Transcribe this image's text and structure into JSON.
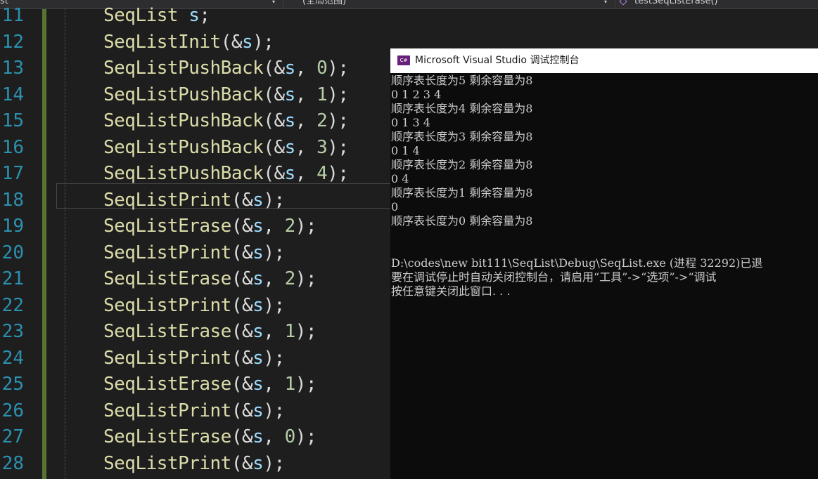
{
  "navbar": {
    "project_dropdown": "st",
    "scope_dropdown": "(全局范围)",
    "member_dropdown": "testSeqListErase()"
  },
  "editor": {
    "lines": [
      {
        "num": "11",
        "tokens": [
          [
            "fn",
            "SeqList"
          ],
          [
            "punc",
            " "
          ],
          [
            "var",
            "s"
          ],
          [
            "punc",
            ";"
          ]
        ]
      },
      {
        "num": "12",
        "tokens": [
          [
            "fn",
            "SeqListInit"
          ],
          [
            "punc",
            "(&"
          ],
          [
            "var",
            "s"
          ],
          [
            "punc",
            ");"
          ]
        ]
      },
      {
        "num": "13",
        "tokens": [
          [
            "fn",
            "SeqListPushBack"
          ],
          [
            "punc",
            "(&"
          ],
          [
            "var",
            "s"
          ],
          [
            "punc",
            ", "
          ],
          [
            "num",
            "0"
          ],
          [
            "punc",
            ");"
          ]
        ]
      },
      {
        "num": "14",
        "tokens": [
          [
            "fn",
            "SeqListPushBack"
          ],
          [
            "punc",
            "(&"
          ],
          [
            "var",
            "s"
          ],
          [
            "punc",
            ", "
          ],
          [
            "num",
            "1"
          ],
          [
            "punc",
            ");"
          ]
        ]
      },
      {
        "num": "15",
        "tokens": [
          [
            "fn",
            "SeqListPushBack"
          ],
          [
            "punc",
            "(&"
          ],
          [
            "var",
            "s"
          ],
          [
            "punc",
            ", "
          ],
          [
            "num",
            "2"
          ],
          [
            "punc",
            ");"
          ]
        ]
      },
      {
        "num": "16",
        "tokens": [
          [
            "fn",
            "SeqListPushBack"
          ],
          [
            "punc",
            "(&"
          ],
          [
            "var",
            "s"
          ],
          [
            "punc",
            ", "
          ],
          [
            "num",
            "3"
          ],
          [
            "punc",
            ");"
          ]
        ]
      },
      {
        "num": "17",
        "tokens": [
          [
            "fn",
            "SeqListPushBack"
          ],
          [
            "punc",
            "(&"
          ],
          [
            "var",
            "s"
          ],
          [
            "punc",
            ", "
          ],
          [
            "num",
            "4"
          ],
          [
            "punc",
            ");"
          ]
        ]
      },
      {
        "num": "18",
        "tokens": [
          [
            "fn",
            "SeqListPrint"
          ],
          [
            "punc",
            "(&"
          ],
          [
            "var",
            "s"
          ],
          [
            "punc",
            ");"
          ]
        ]
      },
      {
        "num": "19",
        "tokens": [
          [
            "fn",
            "SeqListErase"
          ],
          [
            "punc",
            "(&"
          ],
          [
            "var",
            "s"
          ],
          [
            "punc",
            ", "
          ],
          [
            "num",
            "2"
          ],
          [
            "punc",
            ");"
          ]
        ]
      },
      {
        "num": "20",
        "tokens": [
          [
            "fn",
            "SeqListPrint"
          ],
          [
            "punc",
            "(&"
          ],
          [
            "var",
            "s"
          ],
          [
            "punc",
            ");"
          ]
        ]
      },
      {
        "num": "21",
        "tokens": [
          [
            "fn",
            "SeqListErase"
          ],
          [
            "punc",
            "(&"
          ],
          [
            "var",
            "s"
          ],
          [
            "punc",
            ", "
          ],
          [
            "num",
            "2"
          ],
          [
            "punc",
            ");"
          ]
        ]
      },
      {
        "num": "22",
        "tokens": [
          [
            "fn",
            "SeqListPrint"
          ],
          [
            "punc",
            "(&"
          ],
          [
            "var",
            "s"
          ],
          [
            "punc",
            ");"
          ]
        ]
      },
      {
        "num": "23",
        "tokens": [
          [
            "fn",
            "SeqListErase"
          ],
          [
            "punc",
            "(&"
          ],
          [
            "var",
            "s"
          ],
          [
            "punc",
            ", "
          ],
          [
            "num",
            "1"
          ],
          [
            "punc",
            ");"
          ]
        ]
      },
      {
        "num": "24",
        "tokens": [
          [
            "fn",
            "SeqListPrint"
          ],
          [
            "punc",
            "(&"
          ],
          [
            "var",
            "s"
          ],
          [
            "punc",
            ");"
          ]
        ]
      },
      {
        "num": "25",
        "tokens": [
          [
            "fn",
            "SeqListErase"
          ],
          [
            "punc",
            "(&"
          ],
          [
            "var",
            "s"
          ],
          [
            "punc",
            ", "
          ],
          [
            "num",
            "1"
          ],
          [
            "punc",
            ");"
          ]
        ]
      },
      {
        "num": "26",
        "tokens": [
          [
            "fn",
            "SeqListPrint"
          ],
          [
            "punc",
            "(&"
          ],
          [
            "var",
            "s"
          ],
          [
            "punc",
            ");"
          ]
        ]
      },
      {
        "num": "27",
        "tokens": [
          [
            "fn",
            "SeqListErase"
          ],
          [
            "punc",
            "(&"
          ],
          [
            "var",
            "s"
          ],
          [
            "punc",
            ", "
          ],
          [
            "num",
            "0"
          ],
          [
            "punc",
            ");"
          ]
        ]
      },
      {
        "num": "28",
        "tokens": [
          [
            "fn",
            "SeqListPrint"
          ],
          [
            "punc",
            "(&"
          ],
          [
            "var",
            "s"
          ],
          [
            "punc",
            ");"
          ]
        ]
      }
    ]
  },
  "console": {
    "title": "Microsoft Visual Studio 调试控制台",
    "icon_label": "C#",
    "lines": [
      "顺序表长度为5 剩余容量为8",
      "0 1 2 3 4",
      "顺序表长度为4 剩余容量为8",
      "0 1 3 4",
      "顺序表长度为3 剩余容量为8",
      "0 1 4",
      "顺序表长度为2 剩余容量为8",
      "0 4",
      "顺序表长度为1 剩余容量为8",
      "0",
      "顺序表长度为0 剩余容量为8",
      "",
      "",
      "D:\\codes\\new bit111\\SeqList\\Debug\\SeqList.exe (进程 32292)已退",
      "要在调试停止时自动关闭控制台，请启用“工具”->“选项”->“调试",
      "按任意键关闭此窗口. . ."
    ]
  },
  "colors": {
    "editor_bg": "#1e1e1e",
    "function": "#dcdcaa",
    "variable": "#9cdcfe",
    "number": "#b5cea8",
    "line_number": "#2b91af",
    "change_bar": "#577430",
    "console_bg": "#0c0c0c",
    "console_text": "#cccccc"
  },
  "icons": {
    "console_app_icon": "visual-studio-icon",
    "member_icon": "method-cube-icon",
    "dropdown_icon": "chevron-down-icon"
  }
}
